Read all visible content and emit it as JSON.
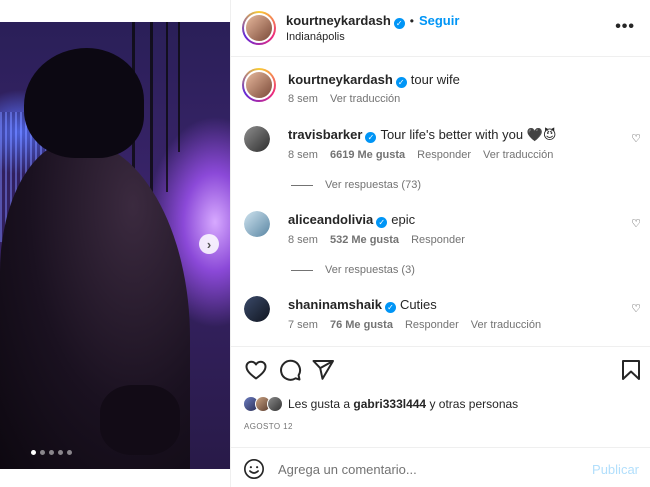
{
  "post": {
    "author": "kourtneykardash",
    "location": "Indianápolis",
    "follow_label": "Seguir",
    "dot": "•",
    "more_icon": "•••"
  },
  "caption": {
    "username": "kourtneykardash",
    "text": "tour wife",
    "age": "8 sem",
    "translate": "Ver traducción"
  },
  "comments": [
    {
      "username": "travisbarker",
      "text": "Tour life's better with you 🖤😈",
      "age": "8 sem",
      "likes": "6619 Me gusta",
      "reply": "Responder",
      "translate": "Ver traducción",
      "view_replies": "Ver respuestas (73)",
      "verified": true
    },
    {
      "username": "aliceandolivia",
      "text": "epic",
      "age": "8 sem",
      "likes": "532 Me gusta",
      "reply": "Responder",
      "view_replies": "Ver respuestas (3)",
      "verified": true
    },
    {
      "username": "shaninamshaik",
      "text": "Cuties",
      "age": "7 sem",
      "likes": "76 Me gusta",
      "reply": "Responder",
      "translate": "Ver traducción",
      "verified": true
    }
  ],
  "likes_summary": {
    "prefix": "Les gusta a",
    "user": "gabri333l444",
    "suffix": "y otras personas"
  },
  "date": "AGOSTO 12",
  "comment_box": {
    "placeholder": "Agrega un comentario...",
    "post_label": "Publicar"
  },
  "carousel": {
    "slides": 5,
    "active": 1
  },
  "colors": {
    "accent": "#0095f6",
    "muted": "#737373",
    "text": "#262626",
    "post_disabled": "#b2dffc"
  },
  "icons": [
    "heart-icon",
    "comment-icon",
    "share-icon",
    "bookmark-icon",
    "emoji-icon",
    "verified-icon",
    "more-icon",
    "chevron-right-icon"
  ]
}
